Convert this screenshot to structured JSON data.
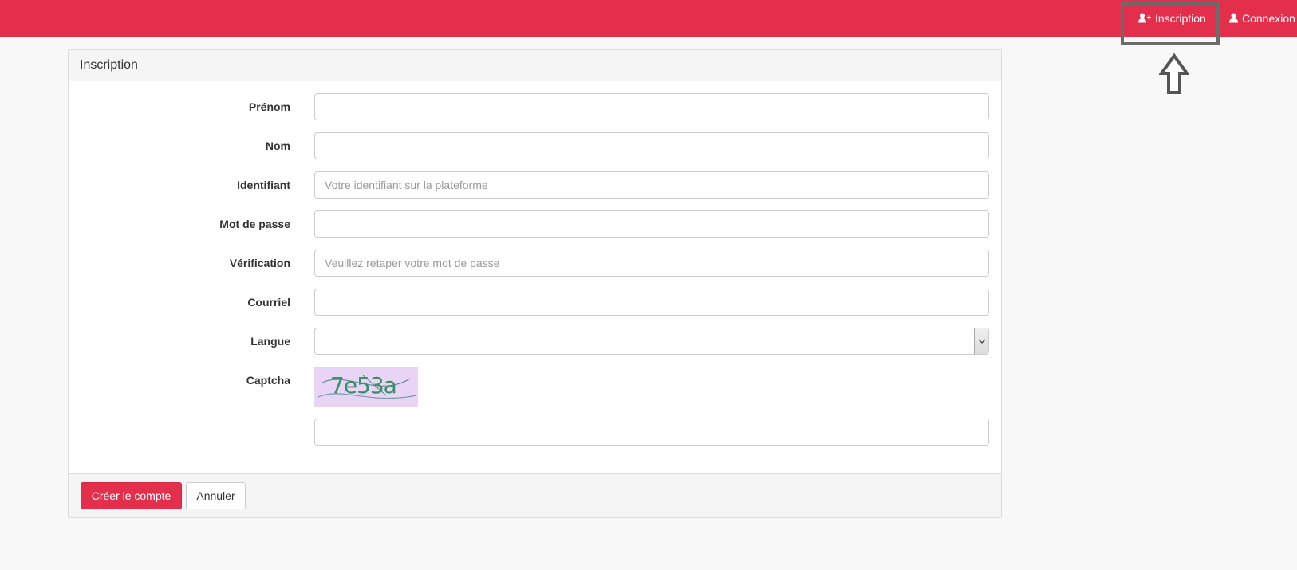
{
  "navbar": {
    "inscription_label": "Inscription",
    "connexion_label": "Connexion"
  },
  "panel": {
    "title": "Inscription"
  },
  "form": {
    "prenom": {
      "label": "Prénom",
      "value": "",
      "placeholder": ""
    },
    "nom": {
      "label": "Nom",
      "value": "",
      "placeholder": ""
    },
    "identifiant": {
      "label": "Identifiant",
      "value": "",
      "placeholder": "Votre identifiant sur la plateforme"
    },
    "mot_de_passe": {
      "label": "Mot de passe",
      "value": "",
      "placeholder": ""
    },
    "verification": {
      "label": "Vérification",
      "value": "",
      "placeholder": "Veuillez retaper votre mot de passe"
    },
    "courriel": {
      "label": "Courriel",
      "value": "",
      "placeholder": ""
    },
    "langue": {
      "label": "Langue",
      "selected": ""
    },
    "captcha": {
      "label": "Captcha",
      "image_text": "7e53a",
      "value": ""
    }
  },
  "footer": {
    "create_label": "Créer le compte",
    "cancel_label": "Annuler"
  },
  "colors": {
    "brand": "#e32f4b",
    "panel_heading_bg": "#f5f5f5",
    "page_bg": "#f8f8f8",
    "captcha_bg": "#e8d5f5",
    "captcha_text": "#3b8f6a"
  },
  "icons": {
    "inscription": "user-plus-icon",
    "connexion": "user-icon",
    "annotation": "arrow-up-outline-icon",
    "select": "chevron-down-icon"
  }
}
